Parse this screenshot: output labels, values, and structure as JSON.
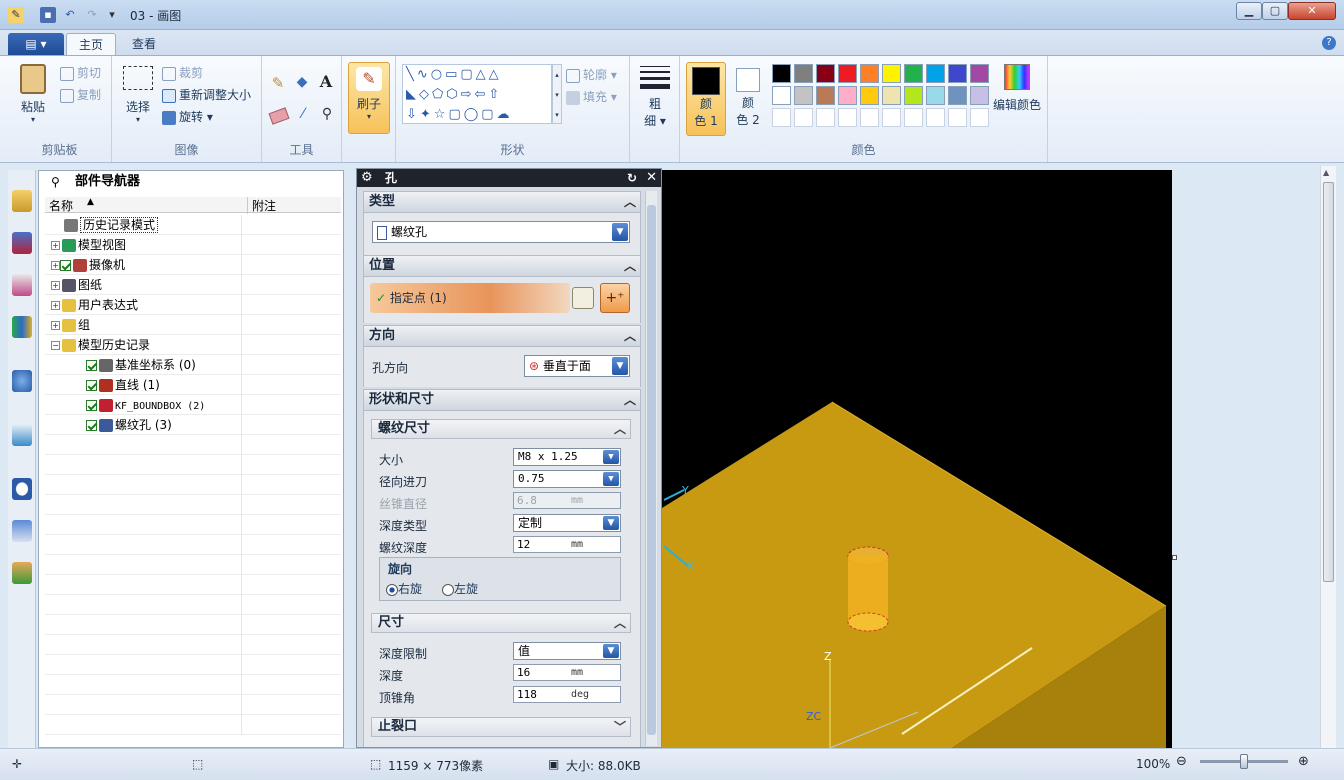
{
  "window": {
    "title": "03 - 画图",
    "minimize": "▁",
    "maximize": "▢",
    "close": "✕"
  },
  "tabs": {
    "file": "▤ ▾",
    "home": "主页",
    "view": "查看",
    "help": "?"
  },
  "clipboard": {
    "paste": "粘贴",
    "cut": "剪切",
    "copy": "复制",
    "label": "剪贴板"
  },
  "image": {
    "select": "选择",
    "crop": "裁剪",
    "resize": "重新调整大小",
    "rotate": "旋转",
    "label": "图像"
  },
  "tools": {
    "label": "工具"
  },
  "brushes": {
    "label": "刷子"
  },
  "shapes": {
    "outline": "轮廓",
    "fill": "填充",
    "label": "形状"
  },
  "size": {
    "line1": "粗",
    "line2": "细"
  },
  "colors": {
    "color1_line1": "颜",
    "color1_line2": "色 1",
    "color2_line1": "颜",
    "color2_line2": "色 2",
    "edit": "编辑颜色",
    "label": "颜色",
    "color1": "#000000",
    "color2": "#ffffff",
    "palette_row1": [
      "#000000",
      "#7f7f7f",
      "#880015",
      "#ed1c24",
      "#ff7f27",
      "#fff200",
      "#22b14c",
      "#00a2e8",
      "#3f48cc",
      "#a349a4"
    ],
    "palette_row2": [
      "#ffffff",
      "#c3c3c3",
      "#b97a57",
      "#ffaec9",
      "#ffc90e",
      "#efe4b0",
      "#b5e61d",
      "#99d9ea",
      "#7092be",
      "#c8bfe7"
    ]
  },
  "navigator": {
    "title": "部件导航器",
    "col_name": "名称",
    "col_note": "附注",
    "rows": [
      {
        "label": "历史记录模式"
      },
      {
        "label": "模型视图"
      },
      {
        "label": "摄像机"
      },
      {
        "label": "图纸"
      },
      {
        "label": "用户表达式"
      },
      {
        "label": "组"
      },
      {
        "label": "模型历史记录"
      },
      {
        "label": "基准坐标系 (0)"
      },
      {
        "label": "直线 (1)"
      },
      {
        "label": "KF_BOUNDBOX (2)"
      },
      {
        "label": "螺纹孔 (3)"
      }
    ]
  },
  "dialog": {
    "title": "孔",
    "type_section": "类型",
    "type_value": "螺纹孔",
    "position_section": "位置",
    "specify_point": "指定点 (1)",
    "direction_section": "方向",
    "hole_direction_label": "孔方向",
    "hole_direction_value": "垂直于面",
    "shape_section": "形状和尺寸",
    "thread_size_section": "螺纹尺寸",
    "size_label": "大小",
    "size_value": "M8 x 1.25",
    "radial_feed_label": "径向进刀",
    "radial_feed_value": "0.75",
    "tap_dia_label": "丝锥直径",
    "tap_dia_value": "6.8",
    "tap_dia_unit": "mm",
    "depth_type_label": "深度类型",
    "depth_type_value": "定制",
    "thread_depth_label": "螺纹深度",
    "thread_depth_value": "12",
    "thread_depth_unit": "mm",
    "rotation_label": "旋向",
    "right_hand": "右旋",
    "left_hand": "左旋",
    "dims_section": "尺寸",
    "depth_limit_label": "深度限制",
    "depth_limit_value": "值",
    "depth_label": "深度",
    "depth_value": "16",
    "depth_unit": "mm",
    "tip_angle_label": "顶锥角",
    "tip_angle_value": "118",
    "tip_angle_unit": "deg",
    "relief_section": "止裂口"
  },
  "viewport": {
    "axis_x": "X",
    "axis_y": "Y",
    "axis_z": "Z",
    "axis_zc": "ZC"
  },
  "status": {
    "dimensions": "1159 × 773像素",
    "filesize": "大小: 88.0KB",
    "zoom": "100%"
  }
}
